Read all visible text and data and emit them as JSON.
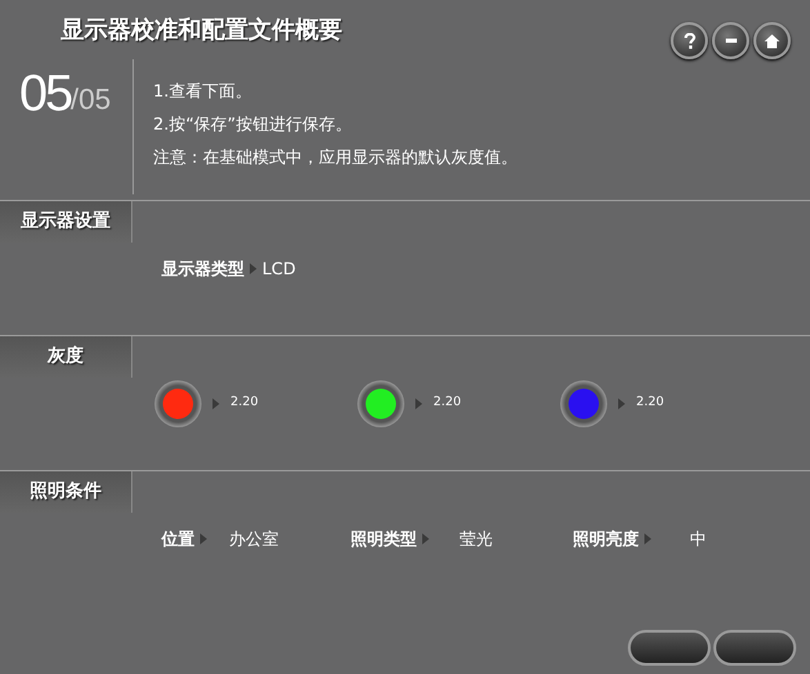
{
  "header": {
    "title": "显示器校准和配置文件概要",
    "step": "05",
    "total": "/05",
    "instructions": [
      "1.查看下面。",
      "2.按“保存”按钮进行保存。",
      "注意：在基础模式中，应用显示器的默认灰度值。"
    ]
  },
  "sections": [
    {
      "kind": "fields",
      "title": "显示器设置",
      "fields": [
        {
          "label": "显示器类型",
          "value": "LCD"
        }
      ]
    },
    {
      "kind": "gray",
      "title": "灰度",
      "channels": [
        {
          "color": "#ff2a10",
          "value": "2.20"
        },
        {
          "color": "#22ee22",
          "value": "2.20"
        },
        {
          "color": "#2a10f0",
          "value": "2.20"
        }
      ]
    },
    {
      "kind": "fields",
      "title": "照明条件",
      "fields": [
        {
          "label": "位置",
          "value": "办公室"
        },
        {
          "label": "照明类型",
          "value": "莹光"
        },
        {
          "label": "照明亮度",
          "value": "中"
        }
      ]
    }
  ]
}
